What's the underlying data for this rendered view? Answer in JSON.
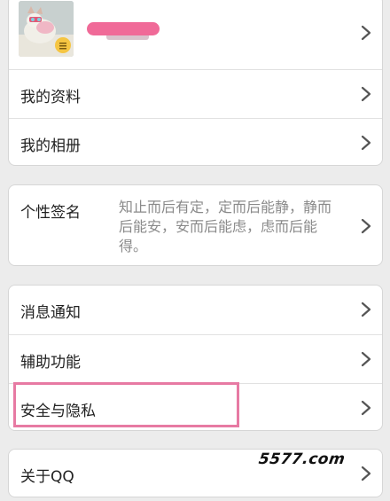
{
  "profile": {
    "menu": [
      {
        "label": "我的资料",
        "icon": "chevron-right-icon"
      },
      {
        "label": "我的相册",
        "icon": "chevron-right-icon"
      }
    ]
  },
  "signature": {
    "label": "个性签名",
    "text": "知止而后有定，定而后能静，静而后能安，安而后能虑，虑而后能得。"
  },
  "settings": {
    "items": [
      {
        "label": "消息通知"
      },
      {
        "label": "辅助功能"
      },
      {
        "label": "安全与隐私"
      }
    ],
    "highlight_color": "#e77aa3"
  },
  "about": {
    "label": "关于QQ"
  },
  "watermark": {
    "text": "5577.com"
  },
  "colors": {
    "background": "#ececec",
    "card": "#ffffff",
    "secondary_text": "#8a8a8a",
    "nickname_blur": "#f06a98"
  }
}
